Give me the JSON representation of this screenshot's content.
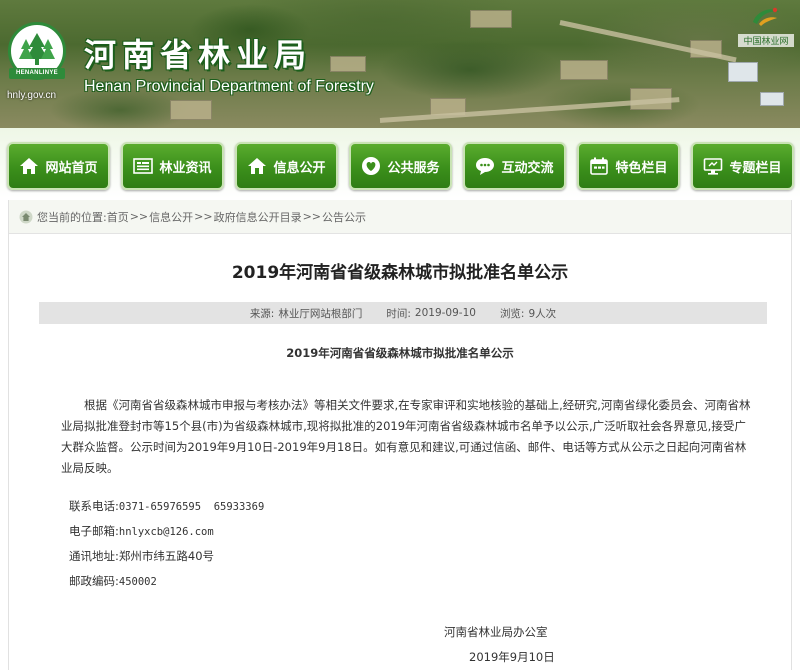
{
  "header": {
    "title_cn": "河南省林业局",
    "title_en": "Henan Provincial Department of Forestry",
    "domain": "hnly.gov.cn",
    "logo_ribbon": "HENANLINYE",
    "partner_logo_text": "中国林业网"
  },
  "nav": {
    "items": [
      {
        "label": "网站首页",
        "icon": "home-icon"
      },
      {
        "label": "林业资讯",
        "icon": "news-list-icon"
      },
      {
        "label": "信息公开",
        "icon": "home-info-icon"
      },
      {
        "label": "公共服务",
        "icon": "heart-service-icon"
      },
      {
        "label": "互动交流",
        "icon": "chat-icon"
      },
      {
        "label": "特色栏目",
        "icon": "calendar-icon"
      },
      {
        "label": "专题栏目",
        "icon": "monitor-icon"
      }
    ]
  },
  "breadcrumb": {
    "prefix": "您当前的位置:",
    "items": [
      "首页",
      "信息公开",
      "政府信息公开目录",
      "公告公示"
    ],
    "separator": ">>"
  },
  "article": {
    "title": "2019年河南省省级森林城市拟批准名单公示",
    "meta": {
      "source_label": "来源:",
      "source": "林业厅网站根部门",
      "time_label": "时间:",
      "time": "2019-09-10",
      "views_label": "浏览:",
      "views": "9人次"
    },
    "sub_title": "2019年河南省省级森林城市拟批准名单公示",
    "paragraph": "根据《河南省省级森林城市申报与考核办法》等相关文件要求,在专家审评和实地核验的基础上,经研究,河南省绿化委员会、河南省林业局拟批准登封市等15个县(市)为省级森林城市,现将拟批准的2019年河南省省级森林城市名单予以公示,广泛听取社会各界意见,接受广大群众监督。公示时间为2019年9月10日-2019年9月18日。如有意见和建议,可通过信函、邮件、电话等方式从公示之日起向河南省林业局反映。",
    "contacts": {
      "phone_label": "联系电话:",
      "phone": "0371-65976595  65933369",
      "email_label": "电子邮箱:",
      "email": "hnlyxcb@126.com",
      "address_label": "通讯地址:",
      "address": "郑州市纬五路40号",
      "postcode_label": "邮政编码:",
      "postcode": "450002"
    },
    "signature": "河南省林业局办公室",
    "sign_date": "2019年9月10日"
  },
  "colors": {
    "nav_green": "#3b8f1b",
    "title_outline": "#1c5e1c",
    "meta_bar": "#e3e3e3"
  }
}
